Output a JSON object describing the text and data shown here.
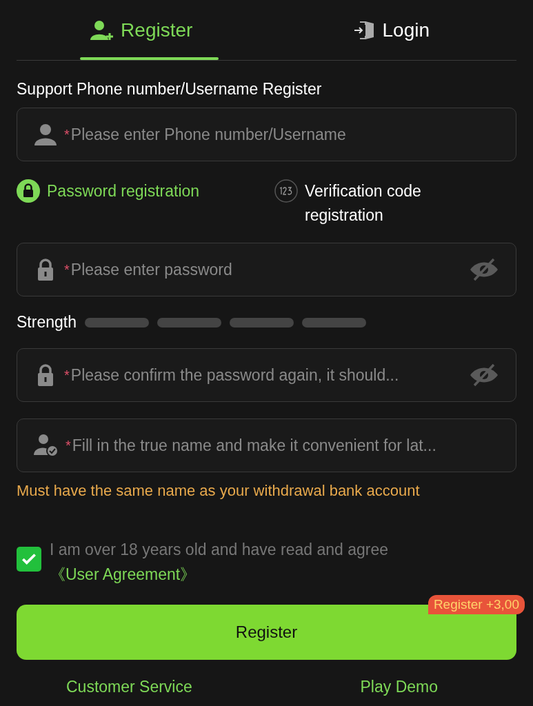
{
  "tabs": [
    {
      "label": "Register",
      "kind": "register",
      "selected": true
    },
    {
      "label": "Login",
      "kind": "login",
      "selected": false
    }
  ],
  "section_label": "Support Phone number/Username Register",
  "username_field": {
    "kind": "user",
    "required_mark": "*",
    "placeholder": "Please enter Phone number/Username"
  },
  "methods": [
    {
      "label": "Password registration",
      "kind": "lock",
      "selected": true
    },
    {
      "label": "Verification code registration",
      "kind": "code",
      "selected": false
    }
  ],
  "password_field": {
    "kind": "lock",
    "required_mark": "*",
    "placeholder": "Please enter password",
    "reveal": true
  },
  "strength": {
    "label": "Strength"
  },
  "fields": [
    {
      "kind": "lock",
      "required_mark": "*",
      "placeholder": "Please confirm the password again, it should...",
      "reveal": true
    },
    {
      "kind": "person-check",
      "required_mark": "*",
      "placeholder": "Fill in the true name and make it convenient for lat...",
      "reveal": false
    }
  ],
  "name_hint": "Must have the same name as your withdrawal bank account",
  "agreement": {
    "checked": true,
    "text": "I am over 18 years old and have read and agree ",
    "link": "《User Agreement》"
  },
  "submit": {
    "label": "Register",
    "badge": "Register +3,00"
  },
  "footer_links": [
    "Customer Service",
    "Play Demo"
  ]
}
